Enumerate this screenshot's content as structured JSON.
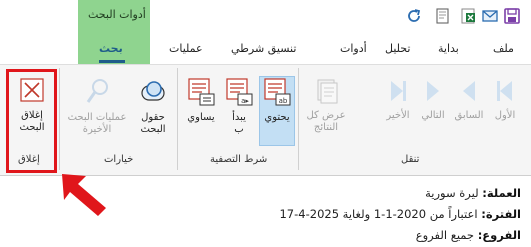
{
  "context": {
    "group_label": "أدوات البحث"
  },
  "tabs": [
    {
      "label": "ملف"
    },
    {
      "label": "بداية"
    },
    {
      "label": "تحليل"
    },
    {
      "label": "أدوات"
    },
    {
      "label": "تنسيق شرطي"
    },
    {
      "label": "عمليات"
    },
    {
      "label": "بحث",
      "active": true
    }
  ],
  "ribbon": {
    "navigation": {
      "label": "تنقل",
      "first": "الأول",
      "previous": "السابق",
      "next": "التالي",
      "last": "الأخير",
      "show_all": "عرض كل\nالنتائج"
    },
    "filter": {
      "label": "شرط التصفية",
      "contains": "يحتوي",
      "starts_with": "يبدأ\nب",
      "equals": "يساوي"
    },
    "options": {
      "label": "خيارات",
      "search_fields": "حقول\nالبحث",
      "other_searches": "عمليات البحث\nالأخيرة"
    },
    "close": {
      "label": "إغلاق",
      "close_search": "إغلاق\nالبحث"
    }
  },
  "info": {
    "currency_label": "العملة:",
    "currency_value": "ليرة سورية",
    "period_label": "الفترة:",
    "period_value": "اعتباراً من 2020-1-1 ولغاية 2025-4-17",
    "branches_label": "الفروع:",
    "branches_value": "جميع الفروع"
  },
  "colors": {
    "accent": "#1f5d8a",
    "context_tab": "#8fd48f",
    "highlight": "#e0161b"
  }
}
